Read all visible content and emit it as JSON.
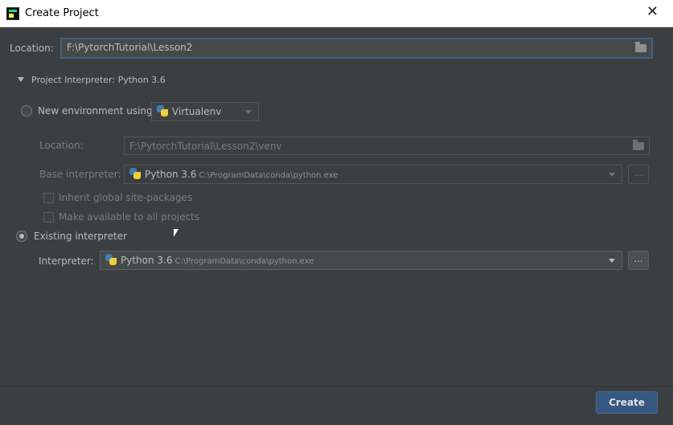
{
  "window": {
    "title": "Create Project",
    "close_glyph": "✕"
  },
  "location": {
    "label": "Location:",
    "value": "F:\\PytorchTutorial\\Lesson2"
  },
  "interpreter_section": {
    "header": "Project Interpreter: Python 3.6"
  },
  "new_env": {
    "radio_label": "New environment using",
    "tool": "Virtualenv",
    "location_label": "Location:",
    "location_value": "F:\\PytorchTutorial\\Lesson2\\venv",
    "base_label": "Base interpreter:",
    "base_name": "Python 3.6",
    "base_path": "C:\\ProgramData\\conda\\python.exe",
    "inherit_label": "Inherit global site-packages",
    "available_label": "Make available to all projects",
    "ellipsis": "..."
  },
  "existing": {
    "radio_label": "Existing interpreter",
    "interpreter_label": "Interpreter:",
    "interpreter_name": "Python 3.6",
    "interpreter_path": "C:\\ProgramData\\conda\\python.exe",
    "ellipsis": "..."
  },
  "footer": {
    "create_label": "Create"
  },
  "colors": {
    "background": "#3c3f41",
    "accent": "#365880",
    "focus_border": "#3d6185"
  },
  "icons": [
    "app-icon",
    "close-icon",
    "folder-icon",
    "python-icon",
    "chevron-down-icon",
    "disclosure-triangle-icon"
  ]
}
